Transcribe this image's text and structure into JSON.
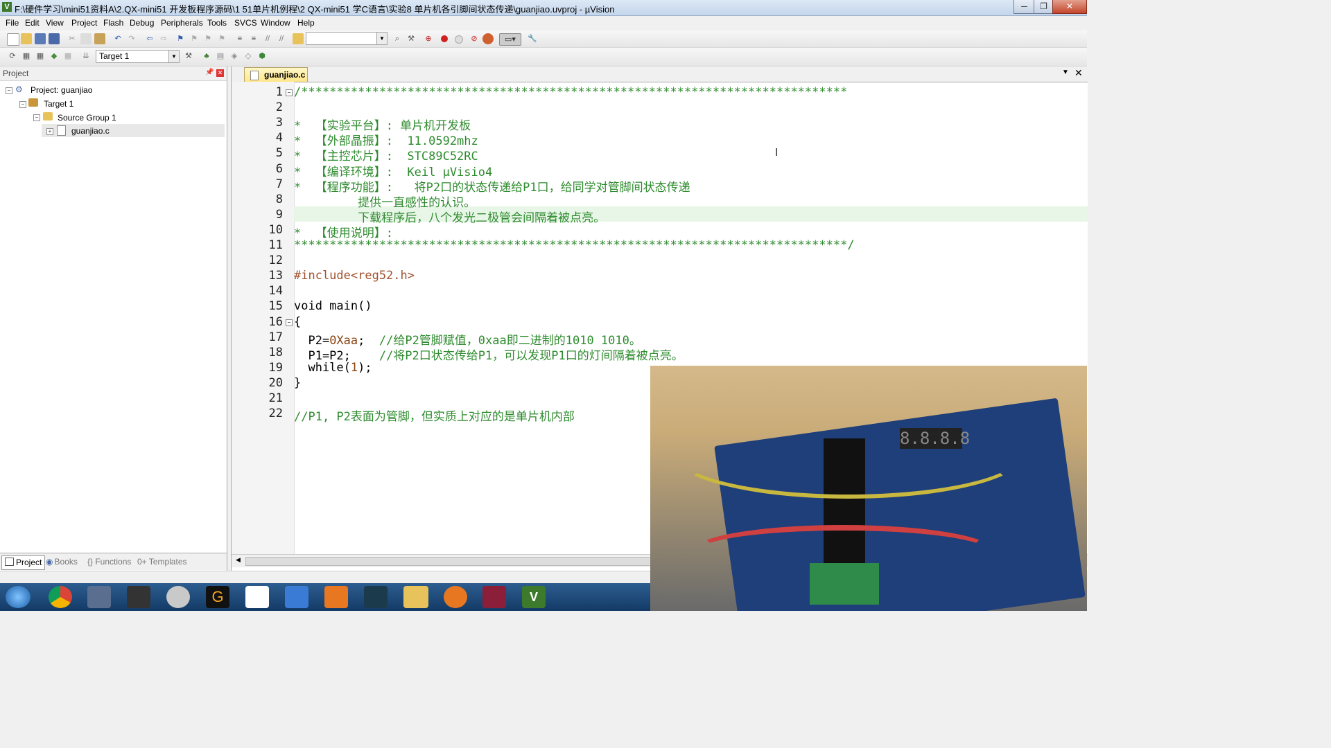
{
  "window": {
    "title": "F:\\硬件学习\\mini51资料A\\2.QX-mini51 开发板程序源码\\1 51单片机例程\\2 QX-mini51 学C语言\\实验8 单片机各引脚间状态传递\\guanjiao.uvproj - µVision",
    "app_icon": "V",
    "minimize": "─",
    "maximize": "❐",
    "close": "✕"
  },
  "menu": [
    "File",
    "Edit",
    "View",
    "Project",
    "Flash",
    "Debug",
    "Peripherals",
    "Tools",
    "SVCS",
    "Window",
    "Help"
  ],
  "toolbar2": {
    "target_select": "Target 1"
  },
  "project_panel": {
    "header": "Project",
    "tree": {
      "project": "Project: guanjiao",
      "target": "Target 1",
      "group": "Source Group 1",
      "file": "guanjiao.c"
    },
    "tabs": [
      "Project",
      "Books",
      "{} Functions",
      "0+ Templates"
    ]
  },
  "editor": {
    "tab": "guanjiao.c",
    "lines": [
      "/*****************************************************************************",
      "",
      "*  【实验平台】: 单片机开发板",
      "*  【外部晶振】:  11.0592mhz",
      "*  【主控芯片】:  STC89C52RC",
      "*  【编译环境】:  Keil µVisio4",
      "*  【程序功能】:   将P2口的状态传递给P1口，给同学对管脚间状态传递",
      "         提供一直感性的认识。",
      "         下载程序后，八个发光二极管会间隔着被点亮。",
      "*  【使用说明】:",
      "******************************************************************************/",
      "",
      "#include<reg52.h>",
      "",
      "void main()",
      "{",
      "  P2=0Xaa;  //给P2管脚赋值，0xaa即二进制的1010 1010。",
      "  P1=P2;    //将P2口状态传给P1，可以发现P1口的灯间隔着被点亮。",
      "  while(1);",
      "}",
      "",
      "//P1, P2表面为管脚，但实质上对应的是单片机内部"
    ]
  },
  "taskbar": {
    "icons": [
      "start-orb",
      "chrome",
      "video-tool",
      "clapper",
      "camera",
      "g-app",
      "network-app",
      "bird-app",
      "pdf-app",
      "media-app",
      "folder",
      "flame-app",
      "chart-app",
      "keil-app"
    ]
  }
}
